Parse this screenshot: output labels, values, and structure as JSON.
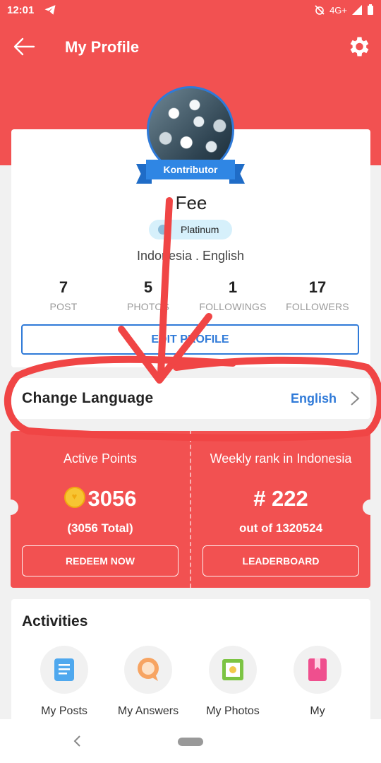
{
  "status_bar": {
    "time": "12:01",
    "network": "4G+"
  },
  "header": {
    "title": "My Profile",
    "back_icon": "arrow-left-icon",
    "settings_icon": "gear-icon"
  },
  "profile": {
    "badge": "Kontributor",
    "name": "Fee",
    "tier": "Platinum",
    "locale": "Indonesia . English",
    "stats": [
      {
        "value": "7",
        "label": "POST"
      },
      {
        "value": "5",
        "label": "PHOTOS"
      },
      {
        "value": "1",
        "label": "FOLLOWINGS"
      },
      {
        "value": "17",
        "label": "FOLLOWERS"
      }
    ],
    "edit_button": "EDIT PROFILE"
  },
  "language": {
    "title": "Change Language",
    "value": "English"
  },
  "points": {
    "active_title": "Active Points",
    "active_value": "3056",
    "active_total": "(3056 Total)",
    "redeem_button": "REDEEM NOW",
    "rank_title": "Weekly rank in Indonesia",
    "rank_value": "# 222",
    "rank_sub": "out of 1320524",
    "leaderboard_button": "LEADERBOARD"
  },
  "activities": {
    "title": "Activities",
    "items": [
      {
        "label": "My Posts",
        "icon": "document-icon"
      },
      {
        "label": "My Answers",
        "icon": "speech-bubble-icon"
      },
      {
        "label": "My Photos",
        "icon": "photo-icon"
      },
      {
        "label": "My",
        "icon": "bookmark-icon"
      }
    ]
  },
  "colors": {
    "primary_red": "#f25151",
    "accent_blue": "#2f7ad8",
    "annotation_red": "#f04545"
  }
}
